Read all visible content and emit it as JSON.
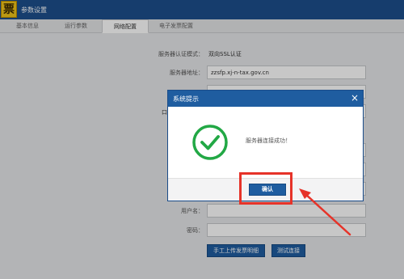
{
  "app": {
    "logo_char": "票",
    "title": "参数设置"
  },
  "tabs": [
    {
      "label": "基本信息"
    },
    {
      "label": "运行参数"
    },
    {
      "label": "网络配置"
    },
    {
      "label": "电子发票配置"
    }
  ],
  "form": {
    "auth_mode_label": "服务器认证模式：",
    "auth_mode_value": "双向SSL认证",
    "server_addr_label": "服务器地址：",
    "server_addr_value": "zzsfp.xj-n-tax.gov.cn",
    "port_label_fragment": "口",
    "username_label": "用户名：",
    "username_value": "",
    "password_label": "密码：",
    "password_value": ""
  },
  "buttons": {
    "manual_upload": "手工上传发票明细",
    "test_connection": "测试连接"
  },
  "dialog": {
    "title": "系统提示",
    "close": "×",
    "message": "服务器连接成功！",
    "ok": "确认"
  },
  "colors": {
    "titlebar": "#1d4f8c",
    "accent": "#1f5da0",
    "success": "#22a845",
    "highlight": "#e63329"
  }
}
